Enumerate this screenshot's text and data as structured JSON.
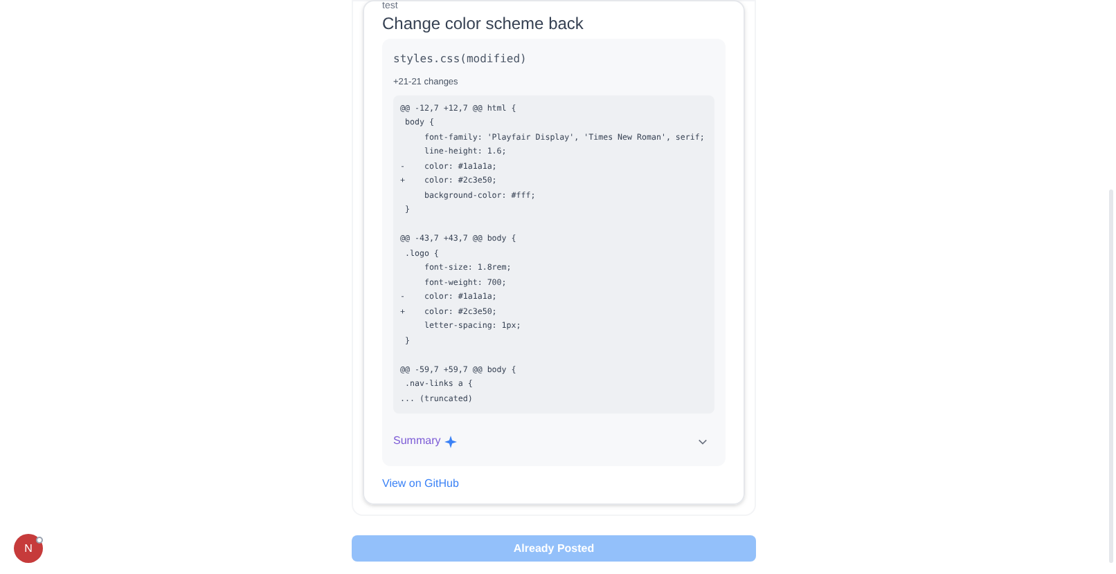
{
  "commit": {
    "message": "test",
    "title": "Change color scheme back"
  },
  "file": {
    "name": "styles.css(modified)",
    "changes": "+21-21 changes",
    "diff_hunks": [
      [
        "@@ -12,7 +12,7 @@ html {",
        " body {",
        "     font-family: 'Playfair Display', 'Times New Roman', serif;",
        "     line-height: 1.6;",
        "-    color: #1a1a1a;",
        "+    color: #2c3e50;",
        "     background-color: #fff;",
        " }"
      ],
      [
        "@@ -43,7 +43,7 @@ body {",
        " .logo {",
        "     font-size: 1.8rem;",
        "     font-weight: 700;",
        "-    color: #1a1a1a;",
        "+    color: #2c3e50;",
        "     letter-spacing: 1px;",
        " }"
      ],
      [
        "@@ -59,7 +59,7 @@ body {",
        " .nav-links a {",
        "... (truncated)"
      ]
    ],
    "summary": {
      "label": "Summary",
      "expanded": false
    }
  },
  "link": "View on GitHub",
  "post_button": {
    "label": "Already Posted",
    "disabled": true
  },
  "avatar": {
    "initial": "N"
  }
}
